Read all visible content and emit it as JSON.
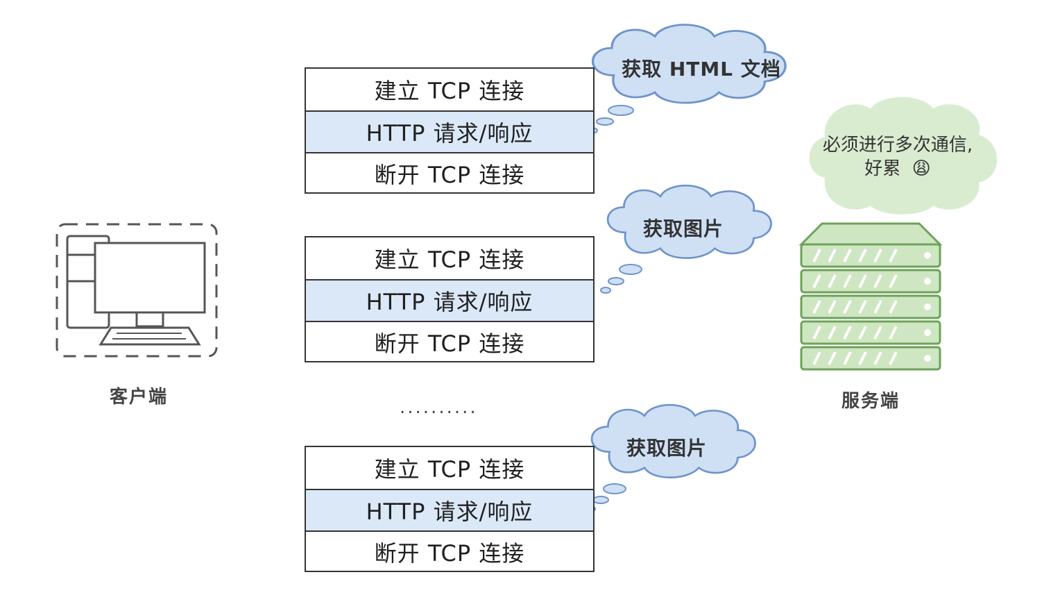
{
  "client": {
    "label": "客户端",
    "icon": "desktop-computer-icon"
  },
  "server": {
    "label": "服务端",
    "icon": "server-rack-icon"
  },
  "server_thought": {
    "line1": "必须进行多次通信,",
    "line2": "好累",
    "emoji": "😩"
  },
  "connections": [
    {
      "steps": [
        "建立 TCP 连接",
        "HTTP 请求/响应",
        "断开 TCP 连接"
      ],
      "thought": "获取 HTML 文档"
    },
    {
      "steps": [
        "建立 TCP 连接",
        "HTTP 请求/响应",
        "断开 TCP 连接"
      ],
      "thought": "获取图片"
    },
    {
      "steps": [
        "建立 TCP 连接",
        "HTTP 请求/响应",
        "断开 TCP 连接"
      ],
      "thought": "获取图片"
    }
  ],
  "ellipsis": "..........",
  "colors": {
    "highlight_row": "#dbe8f8",
    "blue_cloud_fill": "#cfe0f5",
    "blue_cloud_stroke": "#6f94c9",
    "green_cloud_fill": "#d9ecd0",
    "green_server_fill": "#cfe6c2",
    "green_server_stroke": "#6da25a"
  }
}
